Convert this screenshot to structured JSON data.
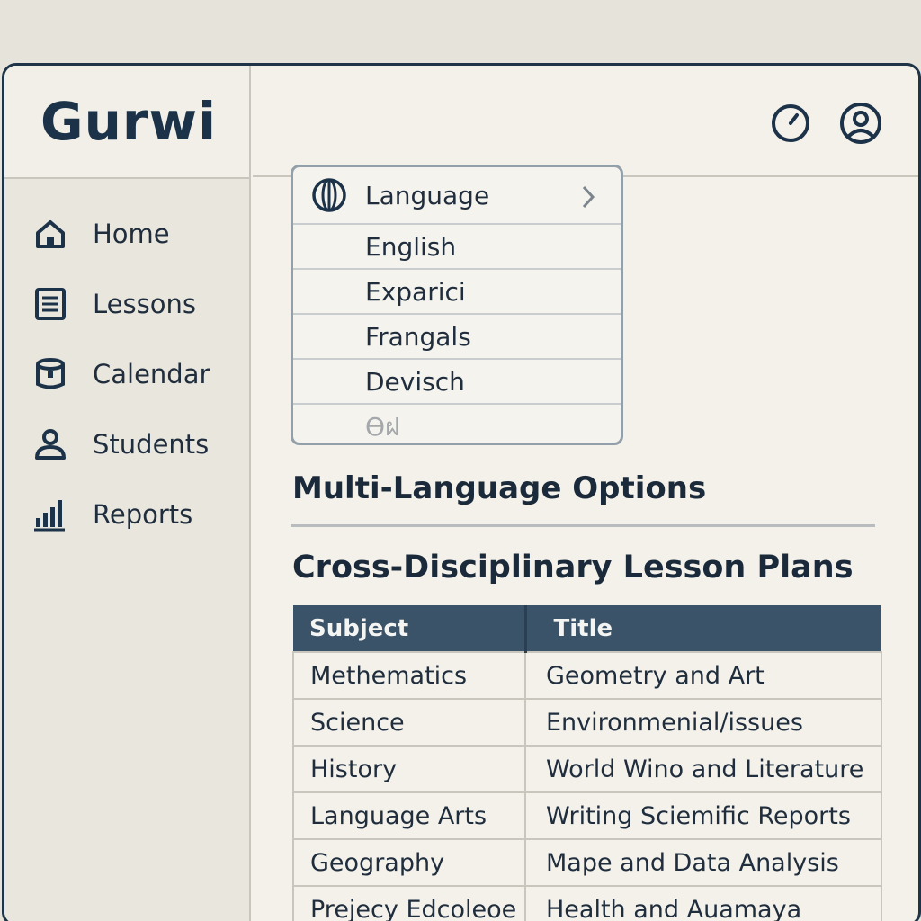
{
  "brand": {
    "name": "Gurwi"
  },
  "sidebar": {
    "items": [
      {
        "label": "Home",
        "icon": "home-icon"
      },
      {
        "label": "Lessons",
        "icon": "document-icon"
      },
      {
        "label": "Calendar",
        "icon": "calendar-icon"
      },
      {
        "label": "Students",
        "icon": "user-icon"
      },
      {
        "label": "Reports",
        "icon": "bar-chart-icon"
      }
    ]
  },
  "topbar": {
    "icons": [
      "clock-icon",
      "account-icon"
    ]
  },
  "language_menu": {
    "title": "Language",
    "icon": "globe-icon",
    "options": [
      "English",
      "Exparici",
      "Frangals",
      "Devisch",
      "Ѳฝ"
    ]
  },
  "sections": {
    "multi_language": "Multi-Language Options",
    "lesson_plans": "Cross-Disciplinary Lesson Plans"
  },
  "table": {
    "headers": [
      "Subject",
      "Title"
    ],
    "rows": [
      [
        "Methematics",
        "Geometry and Art"
      ],
      [
        "Science",
        "Environmenial/issues"
      ],
      [
        "History",
        "World Wino and Literature"
      ],
      [
        "Language Arts",
        "Writing Sciemific Reports"
      ],
      [
        "Geography",
        "Mape and Data Analysis"
      ],
      [
        "Prejecy Edcoleoe",
        "Health and Auamaya"
      ]
    ]
  },
  "colors": {
    "accent": "#1b3248",
    "table_header": "#3a5369",
    "background": "#f3f1ea"
  }
}
